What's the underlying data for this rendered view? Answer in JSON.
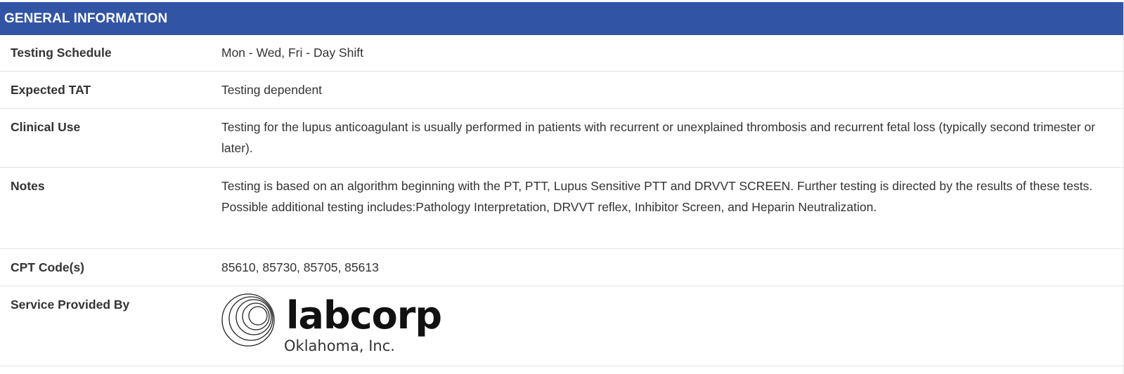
{
  "header": {
    "title": "GENERAL INFORMATION",
    "color": "#3254a5"
  },
  "rows": [
    {
      "label": "Testing Schedule",
      "value": "Mon - Wed, Fri - Day Shift"
    },
    {
      "label": "Expected TAT",
      "value": "Testing dependent"
    },
    {
      "label": "Clinical Use",
      "value": "Testing for the lupus anticoagulant is usually performed in patients with recurrent or unexplained thrombosis and recurrent fetal loss (typically second trimester or later)."
    },
    {
      "label": "Notes",
      "value": "Testing is based on an algorithm beginning with the PT, PTT, Lupus Sensitive PTT and DRVVT SCREEN. Further testing is directed by the results of these tests. Possible additional testing includes:Pathology Interpretation, DRVVT reflex, Inhibitor Screen, and Heparin Neutralization."
    },
    {
      "label": "CPT Code(s)",
      "value": "85610, 85730, 85705, 85613"
    },
    {
      "label": "Service Provided By",
      "value": ""
    }
  ],
  "provider_logo": {
    "name": "labcorp",
    "subtitle": "Oklahoma, Inc.",
    "icon": "labcorp-rings-logo"
  }
}
